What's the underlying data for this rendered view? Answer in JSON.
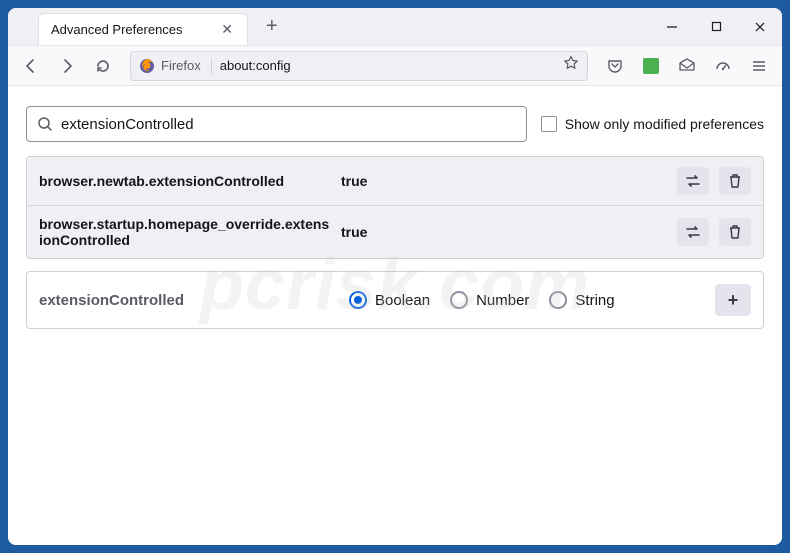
{
  "tab": {
    "title": "Advanced Preferences"
  },
  "url": {
    "identity_label": "Firefox",
    "value": "about:config"
  },
  "search": {
    "value": "extensionControlled",
    "checkbox_label": "Show only modified preferences"
  },
  "prefs": [
    {
      "name": "browser.newtab.extensionControlled",
      "value": "true"
    },
    {
      "name": "browser.startup.homepage_override.extensionControlled",
      "value": "true"
    }
  ],
  "new_pref": {
    "name": "extensionControlled",
    "types": [
      "Boolean",
      "Number",
      "String"
    ],
    "selected": "Boolean"
  },
  "watermark": "pcrisk.com"
}
